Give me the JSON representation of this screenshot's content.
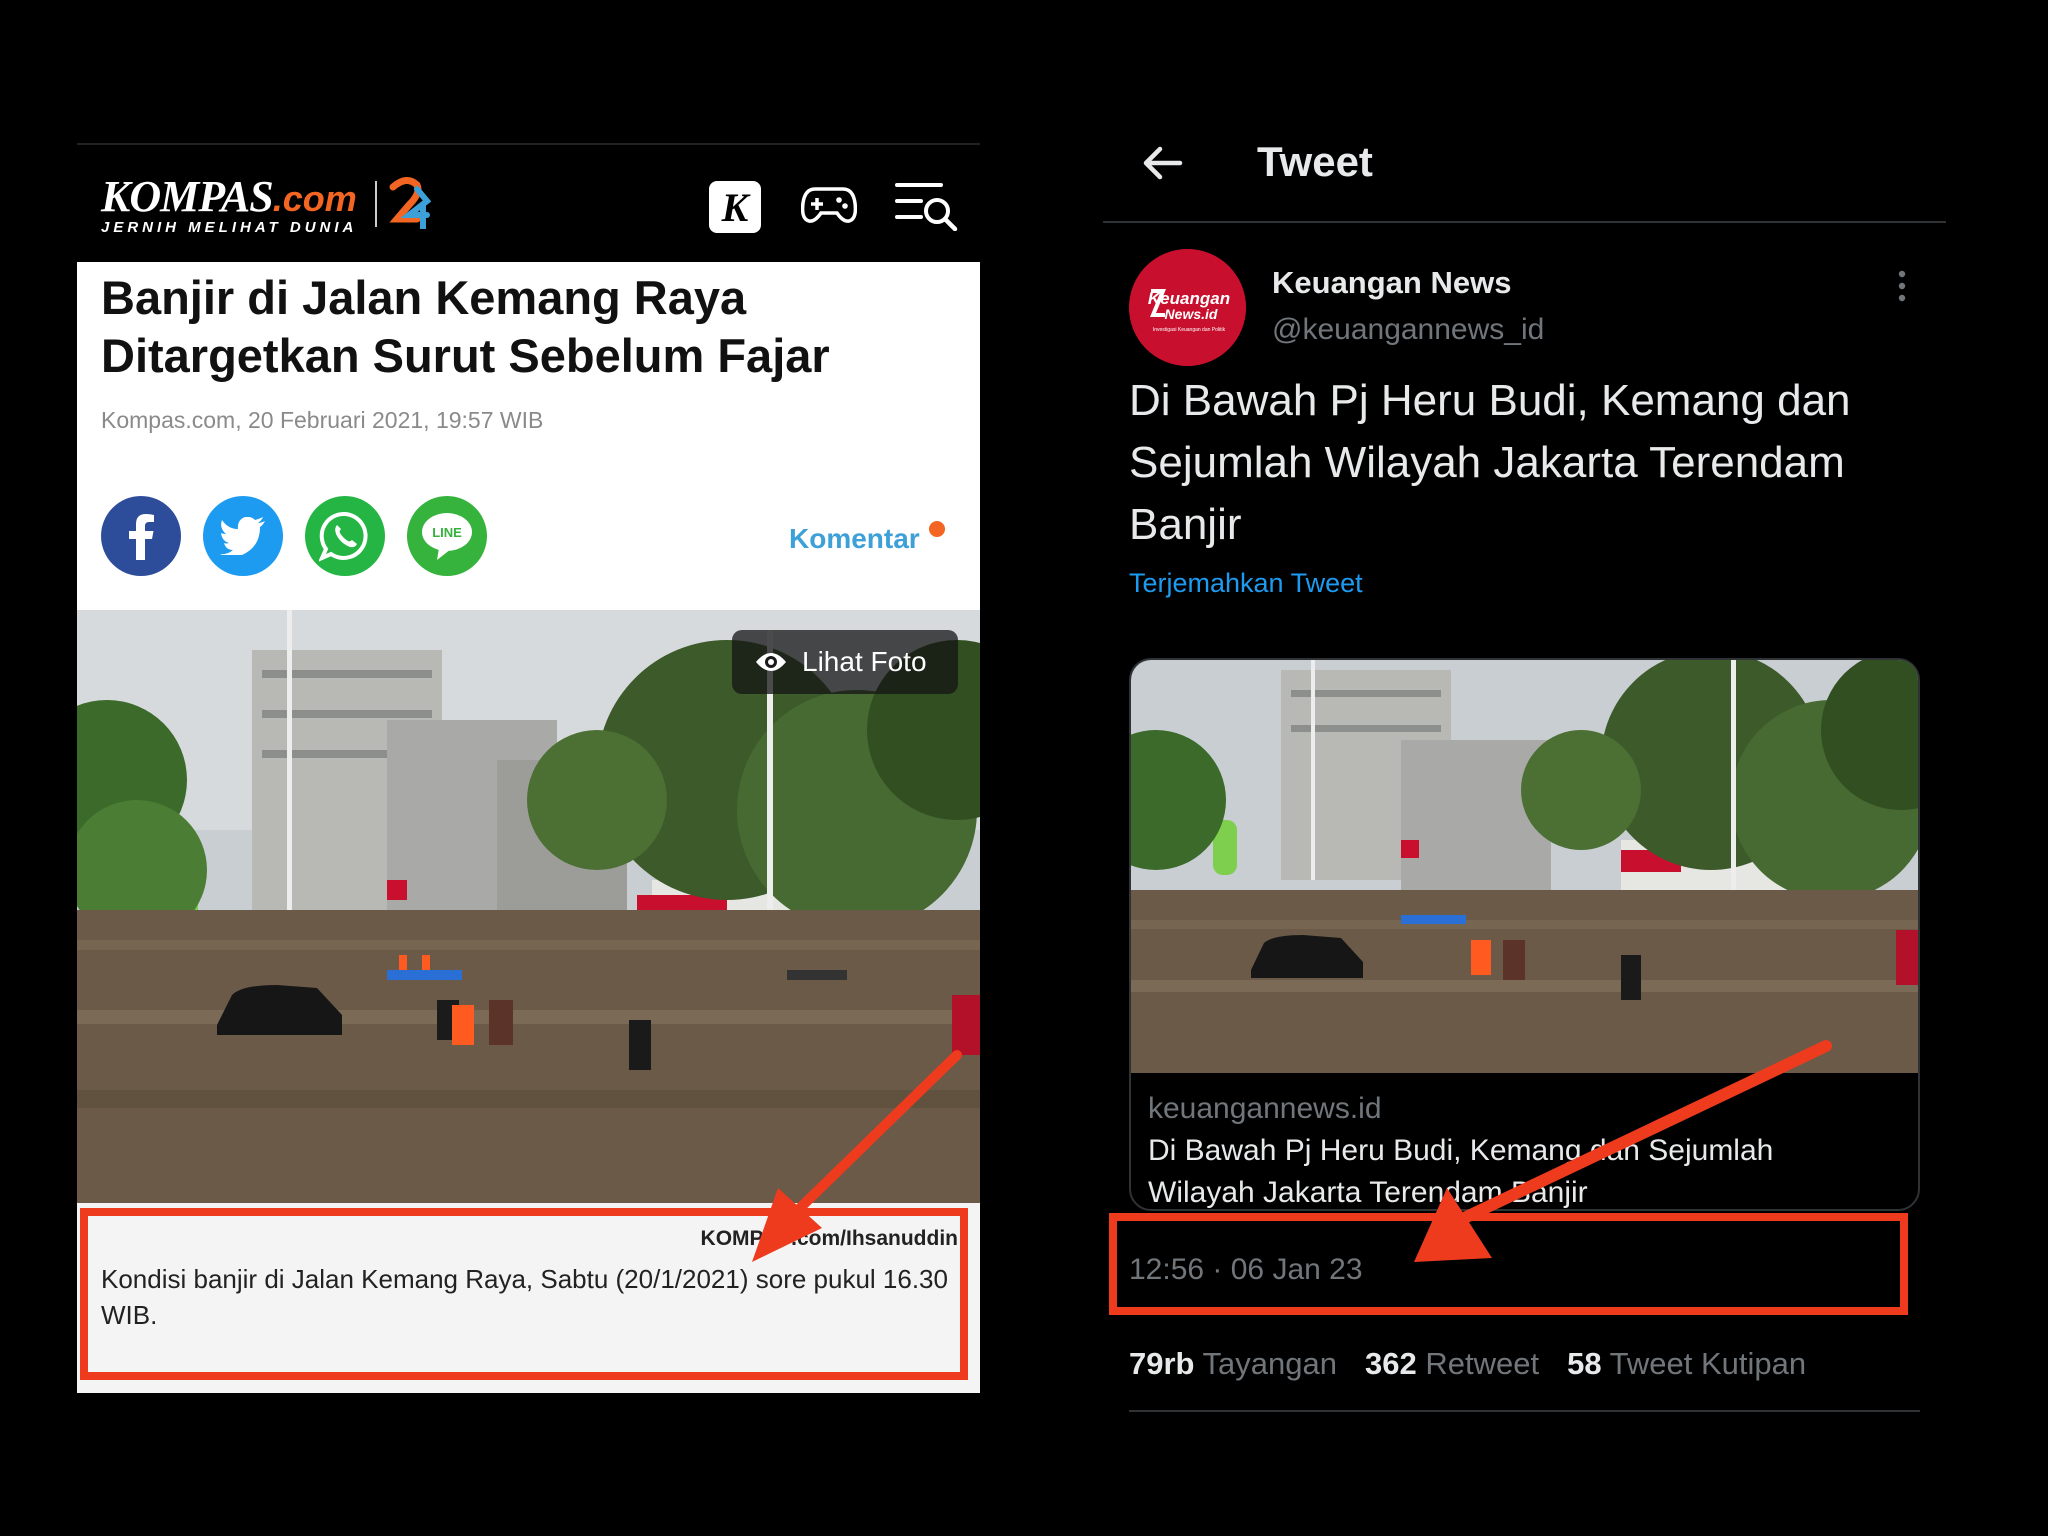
{
  "kompas": {
    "logo_brand": "KOMPAS",
    "logo_dotcom": ".com",
    "logo_tagline": "JERNIH MELIHAT DUNIA",
    "k_icon_letter": "K",
    "icons": [
      "kompas-k-icon",
      "gamepad-icon",
      "menu-search-icon",
      "facebook-icon",
      "twitter-icon",
      "whatsapp-icon",
      "line-icon",
      "eye-icon"
    ],
    "title": "Banjir di Jalan Kemang Raya Ditargetkan Surut Sebelum Fajar",
    "meta": "Kompas.com, 20 Februari 2021, 19:57 WIB",
    "share_line_label": "LINE",
    "komentar_label": "Komentar",
    "lihat_foto_label": "Lihat Foto",
    "photo_credit": "KOMPAS.com/Ihsanuddin",
    "caption": "Kondisi banjir di Jalan Kemang Raya, Sabtu (20/1/2021) sore pukul 16.30 WIB."
  },
  "tweet": {
    "header_title": "Tweet",
    "author_name": "Keuangan News",
    "author_handle": "@keuangannews_id",
    "avatar_text_1": "Keuangan",
    "avatar_text_2": "News.id",
    "avatar_subtext": "Investigasi Keuangan dan Politik",
    "text": "Di Bawah Pj Heru Budi, Kemang dan Sejumlah Wilayah Jakarta Terendam Banjir",
    "translate_label": "Terjemahkan Tweet",
    "card_domain": "keuangannews.id",
    "card_title": "Di Bawah Pj Heru Budi, Kemang dan Sejumlah Wilayah Jakarta Terendam Banjir",
    "timestamp": "12:56 · 06 Jan 23",
    "stats": {
      "views_count": "79rb",
      "views_label": "Tayangan",
      "retweets_count": "362",
      "retweets_label": "Retweet",
      "quotes_count": "58",
      "quotes_label": "Tweet Kutipan"
    }
  },
  "colors": {
    "annotation_red": "#ee3b1e",
    "twitter_blue": "#1d9bf0",
    "kompas_orange": "#f26522",
    "avatar_red": "#c8102e"
  }
}
